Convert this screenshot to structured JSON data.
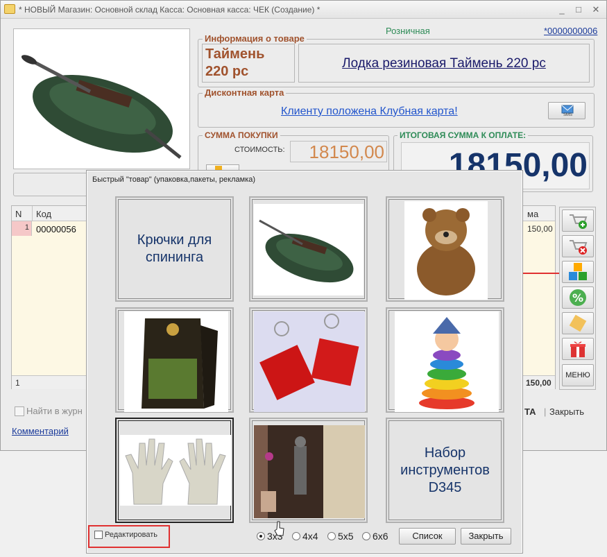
{
  "window": {
    "title": "* НОВЫЙ Магазин: Основной склад Касса: Основная касса: ЧЕК (Создание) *",
    "price_type": "Розничная",
    "receipt_number": "*0000000006"
  },
  "product_info": {
    "legend": "Информация о товаре",
    "short_name": "Таймень 220 рс",
    "full_name": "Лодка резиновая Таймень 220 рс"
  },
  "discount_card": {
    "legend": "Дисконтная карта",
    "message": "Клиенту положена Клубная карта!",
    "sms_label": "SMS"
  },
  "purchase_sum": {
    "legend": "СУММА ПОКУПКИ",
    "cost_label": "СТОИМОСТЬ:",
    "cost_value": "18150,00"
  },
  "total": {
    "legend": "ИТОГОВАЯ СУММА К ОПЛАТЕ:",
    "value": "18150,00"
  },
  "table": {
    "col_n": "N",
    "col_code": "Код",
    "col_sum_partial": "ма",
    "rows": [
      {
        "n": "1",
        "code": "00000056",
        "sum": "150,00"
      }
    ],
    "footer_count": "1",
    "footer_sum": "150,00"
  },
  "side_tools": {
    "menu_label": "МЕНЮ"
  },
  "bottom": {
    "find_label": "Найти в журн",
    "comment_label": "Комментарий",
    "ta_partial": "ТА",
    "close_label": "Закрыть"
  },
  "dialog": {
    "title": "Быстрый \"товар\" (упаковка,пакеты, рекламка)",
    "tiles": [
      {
        "kind": "text",
        "text": "Крючки для спининга"
      },
      {
        "kind": "image",
        "icon": "boat-image"
      },
      {
        "kind": "image",
        "icon": "bear-toy-image"
      },
      {
        "kind": "image",
        "icon": "coffee-pack-image"
      },
      {
        "kind": "image",
        "icon": "earrings-image"
      },
      {
        "kind": "image",
        "icon": "pyramid-toy-image"
      },
      {
        "kind": "image",
        "icon": "gloves-image"
      },
      {
        "kind": "image",
        "icon": "knight-statue-image"
      },
      {
        "kind": "text",
        "text": "Набор инструментов D345"
      }
    ],
    "edit_label": "Редактировать",
    "grid_options": [
      "3x3",
      "4x4",
      "5x5",
      "6x6"
    ],
    "grid_selected": "3x3",
    "list_button": "Список",
    "close_button": "Закрыть"
  },
  "colors": {
    "legend_brown": "#a0522d",
    "legend_green": "#2e8b57",
    "total_blue": "#16346a",
    "highlight_red": "#e03030"
  }
}
